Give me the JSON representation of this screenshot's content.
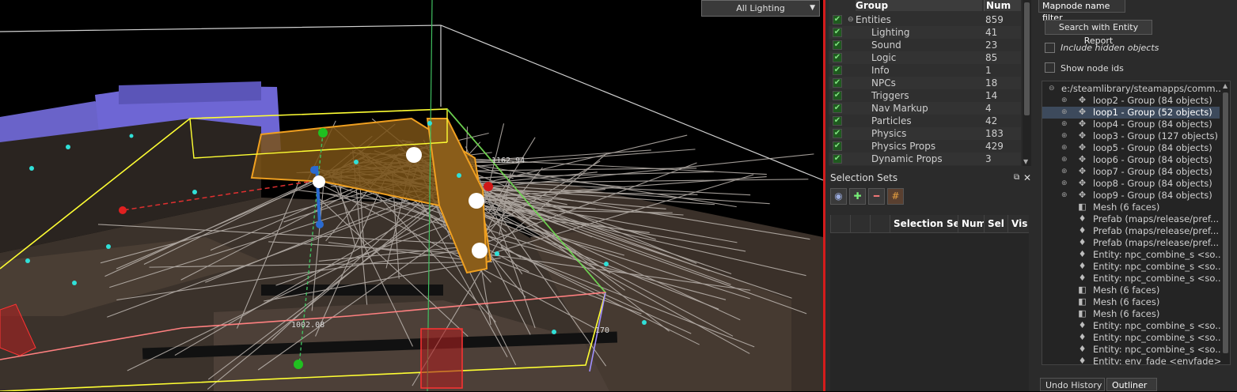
{
  "viewport": {
    "lighting_dropdown": "All Lighting",
    "measure_labels": [
      "1162.94",
      "1002.08",
      "170"
    ]
  },
  "groups": {
    "header": {
      "group": "Group",
      "num": "Num"
    },
    "rows": [
      {
        "name": "Entities",
        "num": "859",
        "root": true
      },
      {
        "name": "Lighting",
        "num": "41"
      },
      {
        "name": "Sound",
        "num": "23"
      },
      {
        "name": "Logic",
        "num": "85"
      },
      {
        "name": "Info",
        "num": "1"
      },
      {
        "name": "NPCs",
        "num": "18"
      },
      {
        "name": "Triggers",
        "num": "14"
      },
      {
        "name": "Nav Markup",
        "num": "4"
      },
      {
        "name": "Particles",
        "num": "42"
      },
      {
        "name": "Physics",
        "num": "183"
      },
      {
        "name": "Physics Props",
        "num": "429"
      },
      {
        "name": "Dynamic Props",
        "num": "3"
      }
    ]
  },
  "selection_sets": {
    "title": "Selection Sets",
    "columns": {
      "name": "Selection Se",
      "num": "Num",
      "sel": "Sel",
      "vis": "Vis"
    }
  },
  "outliner_panel": {
    "filter_tab": "Mapnode name filter",
    "search_button": "Search with Entity Report",
    "include_hidden": "Include hidden objects",
    "show_node_ids": "Show node ids",
    "root": "e:/steamlibrary/steamapps/comm...",
    "items": [
      {
        "label": "loop2 - Group (84 objects)",
        "icon": "move-icon",
        "expand": true
      },
      {
        "label": "loop1 - Group (52 objects)",
        "icon": "move-icon",
        "expand": true,
        "selected": true
      },
      {
        "label": "loop4 - Group (84 objects)",
        "icon": "move-icon",
        "expand": true
      },
      {
        "label": "loop3 - Group (127 objects)",
        "icon": "move-icon",
        "expand": true
      },
      {
        "label": "loop5 - Group (84 objects)",
        "icon": "move-icon",
        "expand": true
      },
      {
        "label": "loop6 - Group (84 objects)",
        "icon": "move-icon",
        "expand": true
      },
      {
        "label": "loop7 - Group (84 objects)",
        "icon": "move-icon",
        "expand": true
      },
      {
        "label": "loop8 - Group (84 objects)",
        "icon": "move-icon",
        "expand": true
      },
      {
        "label": "loop9 - Group (84 objects)",
        "icon": "move-icon",
        "expand": true
      },
      {
        "label": "Mesh (6 faces)",
        "icon": "mesh-icon"
      },
      {
        "label": "Prefab (maps/release/pref...",
        "icon": "entity-icon"
      },
      {
        "label": "Prefab (maps/release/pref...",
        "icon": "entity-icon"
      },
      {
        "label": "Prefab (maps/release/pref...",
        "icon": "entity-icon"
      },
      {
        "label": "Entity: npc_combine_s <so...",
        "icon": "entity-icon"
      },
      {
        "label": "Entity: npc_combine_s <so...",
        "icon": "entity-icon"
      },
      {
        "label": "Entity: npc_combine_s <so...",
        "icon": "entity-icon"
      },
      {
        "label": "Mesh (6 faces)",
        "icon": "mesh-icon"
      },
      {
        "label": "Mesh (6 faces)",
        "icon": "mesh-icon"
      },
      {
        "label": "Mesh (6 faces)",
        "icon": "mesh-icon"
      },
      {
        "label": "Entity: npc_combine_s <so...",
        "icon": "entity-icon"
      },
      {
        "label": "Entity: npc_combine_s <so...",
        "icon": "entity-icon"
      },
      {
        "label": "Entity: npc_combine_s <so...",
        "icon": "entity-icon"
      },
      {
        "label": "Entity: env_fade <envfade>",
        "icon": "entity-icon"
      }
    ],
    "bottom_tabs": [
      "Undo History",
      "Outliner"
    ]
  },
  "colors": {
    "accent_red": "#d41c1c",
    "selection_box": "#ffff33",
    "highlight": "#3d4a5c"
  }
}
